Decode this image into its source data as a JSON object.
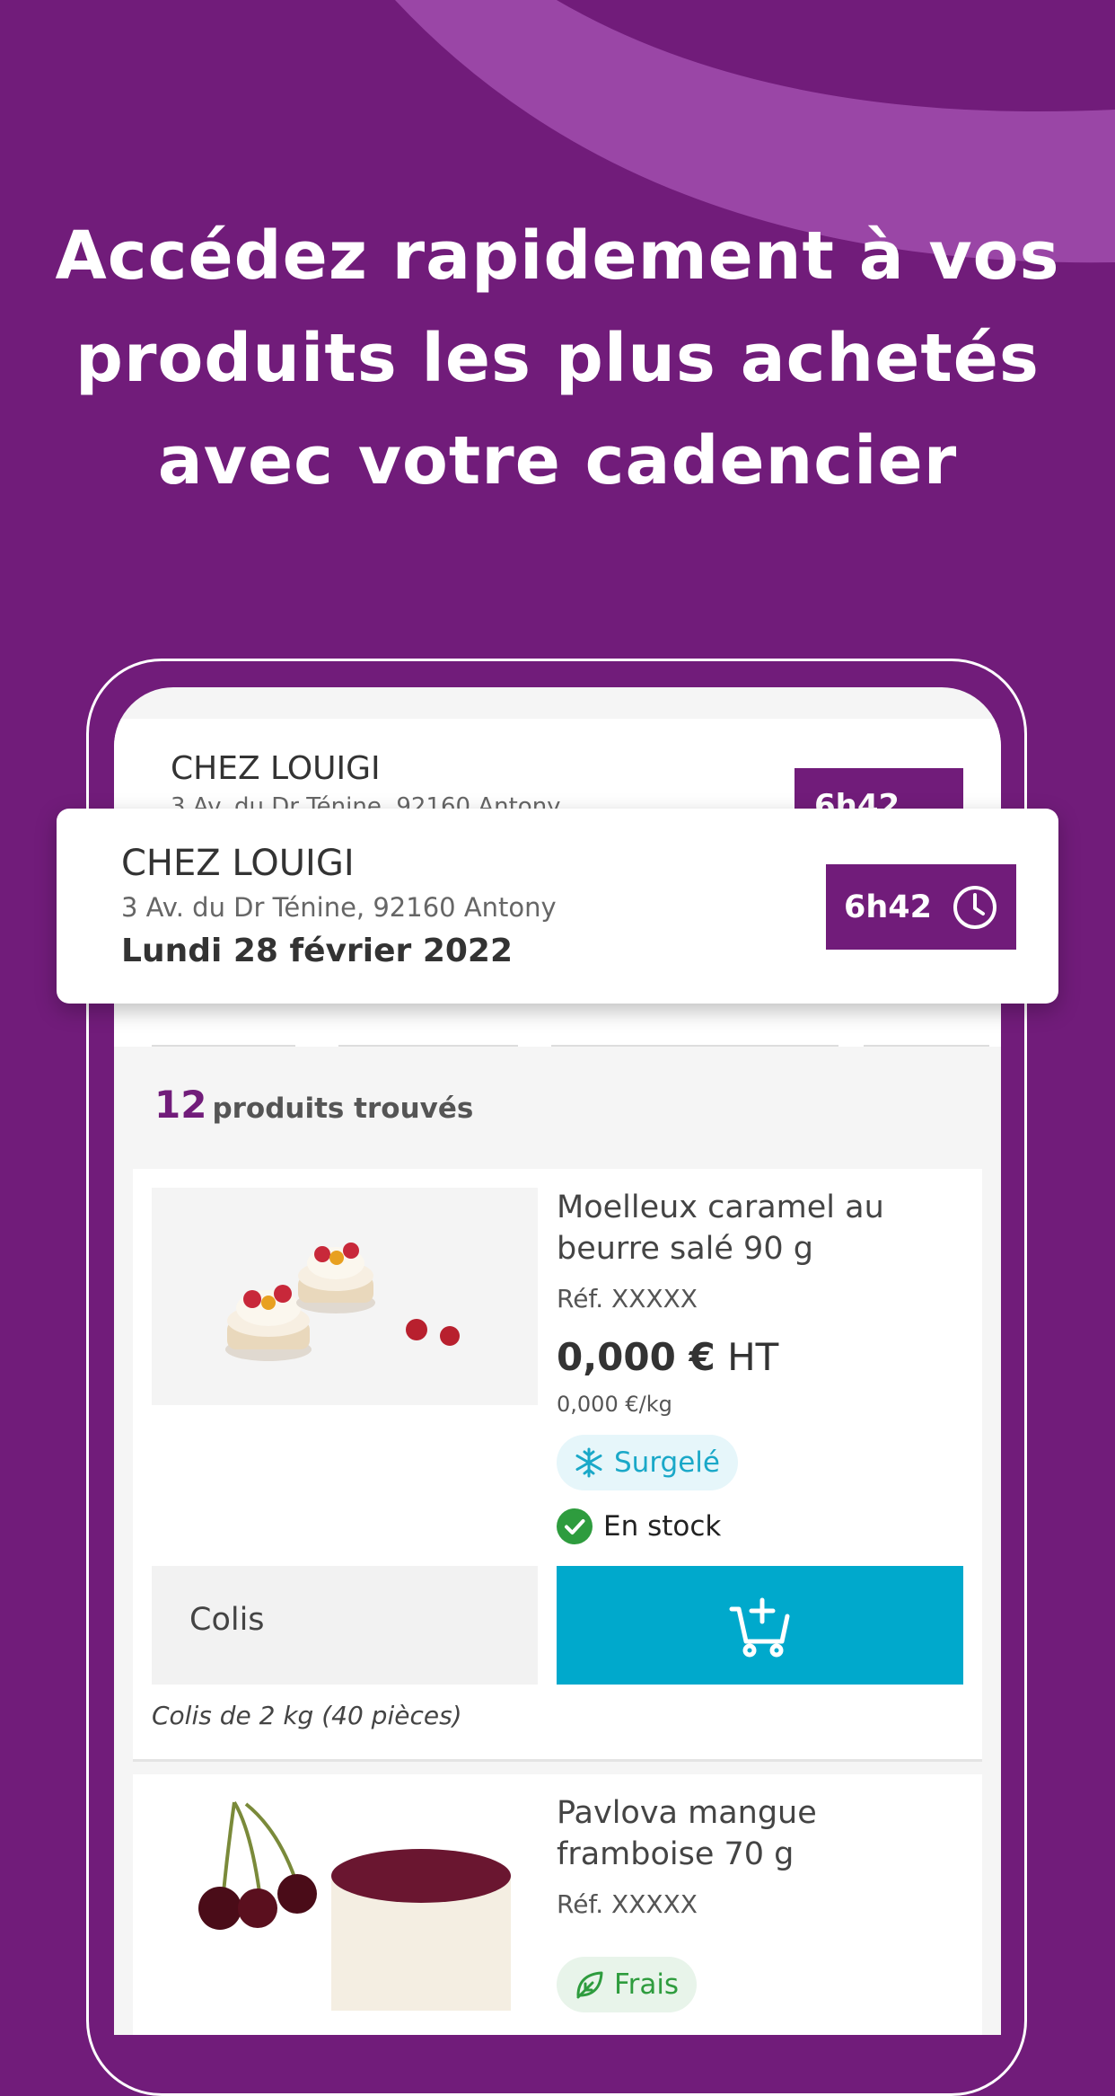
{
  "headline": {
    "line1": "Accédez rapidement à vos",
    "line2": "produits les plus achetés",
    "line3": "avec votre cadencier"
  },
  "store": {
    "name": "CHEZ LOUIGI",
    "address": "3 Av. du Dr Ténine, 92160 Antony",
    "date": "Lundi 28 février 2022",
    "time": "6h42",
    "clock_icon": "clock-icon"
  },
  "results": {
    "count": "12",
    "label": "produits trouvés"
  },
  "products": [
    {
      "title": "Moelleux caramel au beurre salé 90 g",
      "ref": "Réf. XXXXX",
      "price": "0,000 €",
      "price_suffix": "HT",
      "unit_price": "0,000 €/kg",
      "badge": "Surgelé",
      "badge_icon": "snowflake-icon",
      "stock": "En stock",
      "unit_label": "Colis",
      "unit_desc": "Colis de 2 kg (40 pièces)",
      "add_icon": "add-to-cart-icon"
    },
    {
      "title": "Pavlova mangue framboise 70 g",
      "ref": "Réf. XXXXX",
      "badge": "Frais",
      "badge_icon": "leaf-icon"
    }
  ],
  "colors": {
    "brand_purple": "#711c7a",
    "cart_blue": "#00a9cc",
    "stock_green": "#2e9c3e",
    "frozen_cyan": "#1aa8c8"
  }
}
